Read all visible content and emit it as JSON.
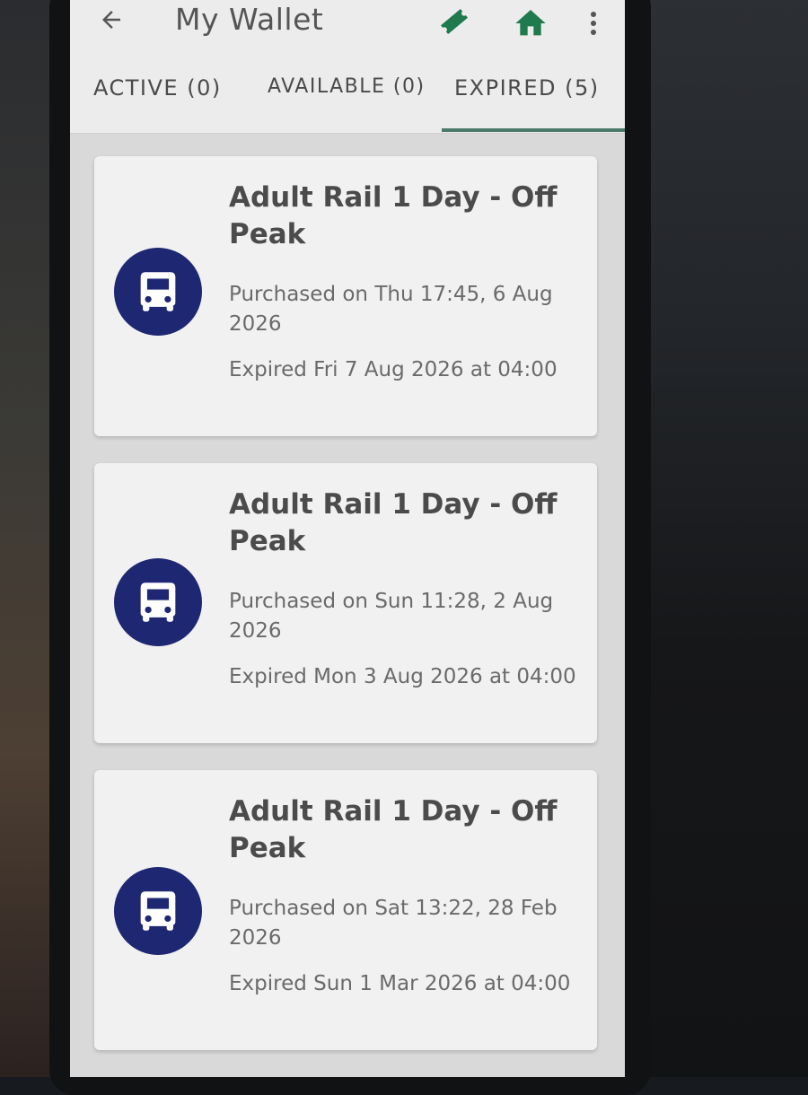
{
  "header": {
    "title": "My Wallet",
    "back_icon": "arrow-left-icon",
    "ticket_icon": "ticket-icon",
    "home_icon": "home-icon",
    "more_icon": "more-vertical-icon",
    "accent_color": "#1f7a4d"
  },
  "tabs": [
    {
      "label": "ACTIVE (0)",
      "selected": false
    },
    {
      "label": "AVAILABLE (0)",
      "selected": false
    },
    {
      "label": "EXPIRED (5)",
      "selected": true
    }
  ],
  "tickets": [
    {
      "icon": "bus-icon",
      "name": "Adult Rail 1 Day - Off Peak",
      "purchased": "Purchased on Thu 17:45, 6 Aug 2026",
      "expired": "Expired Fri 7 Aug 2026 at 04:00"
    },
    {
      "icon": "bus-icon",
      "name": "Adult Rail 1 Day - Off Peak",
      "purchased": "Purchased on Sun 11:28, 2 Aug 2026",
      "expired": "Expired Mon 3 Aug 2026 at 04:00"
    },
    {
      "icon": "bus-icon",
      "name": "Adult Rail 1 Day - Off Peak",
      "purchased": "Purchased on Sat 13:22, 28 Feb 2026",
      "expired": "Expired Sun 1 Mar 2026 at 04:00"
    }
  ],
  "icon_color": "#1e2772"
}
